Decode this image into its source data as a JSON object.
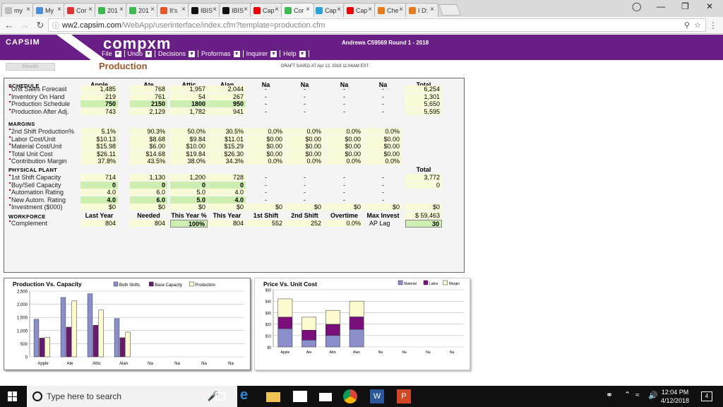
{
  "browser": {
    "tabs": [
      {
        "label": "my",
        "color": "#bdbdbd"
      },
      {
        "label": "My",
        "color": "#4a90d9"
      },
      {
        "label": "Cor",
        "color": "#d33"
      },
      {
        "label": "201",
        "color": "#3cba54"
      },
      {
        "label": "201",
        "color": "#3cba54"
      },
      {
        "label": "It's",
        "color": "#e8572a"
      },
      {
        "label": "IBIS",
        "color": "#111"
      },
      {
        "label": "IBIS",
        "color": "#111"
      },
      {
        "label": "Cap",
        "color": "#e00"
      },
      {
        "label": "Cor",
        "color": "#3cba54"
      },
      {
        "label": "Cap",
        "color": "#27a3d8"
      },
      {
        "label": "Cap",
        "color": "#e00"
      },
      {
        "label": "Che",
        "color": "#e87a1e"
      },
      {
        "label": "I D:",
        "color": "#e87a1e"
      }
    ],
    "active_tab_index": 9,
    "url_host": "ww2.capsim.com",
    "url_path": "/WebApp/userinterface/index.cfm?template=production.cfm"
  },
  "app": {
    "logo": "CAPSIM",
    "brand": "compxm",
    "round_info": "Andrews C59569 Round 1 - 2018",
    "menu": [
      "File",
      "Undo",
      "Decisions",
      "Proformas",
      "Inquirer",
      "Help"
    ],
    "results_button": "Results",
    "page_title": "Production",
    "draft_saved": "DRAFT SAVED AT Apr 12, 2018 11:04AM EST"
  },
  "products": [
    "Apple",
    "Ate",
    "Attic",
    "Alan",
    "Na",
    "Na",
    "Na",
    "Na"
  ],
  "total_label": "Total",
  "schedule": {
    "title": "SCHEDULE",
    "rows": [
      {
        "label": "Unit Sales Forecast",
        "values": [
          "1,485",
          "768",
          "1,957",
          "2,044",
          "-",
          "-",
          "-",
          "-"
        ],
        "total": "6,254"
      },
      {
        "label": "Inventory On Hand",
        "values": [
          "219",
          "761",
          "54",
          "267",
          "-",
          "-",
          "-",
          "-"
        ],
        "total": "1,301"
      },
      {
        "label": "Production Schedule",
        "values": [
          "750",
          "2150",
          "1800",
          "950",
          "-",
          "-",
          "-",
          "-"
        ],
        "total": "5,650"
      },
      {
        "label": "Production After Adj.",
        "values": [
          "743",
          "2,129",
          "1,782",
          "941",
          "-",
          "-",
          "-",
          "-"
        ],
        "total": "5,595"
      }
    ]
  },
  "margins": {
    "title": "MARGINS",
    "rows": [
      {
        "label": "2nd Shift Production%",
        "values": [
          "5.1%",
          "90.3%",
          "50.0%",
          "30.5%",
          "0.0%",
          "0.0%",
          "0.0%",
          "0.0%"
        ]
      },
      {
        "label": "Labor Cost/Unit",
        "values": [
          "$10.13",
          "$8.68",
          "$9.84",
          "$11.01",
          "$0.00",
          "$0.00",
          "$0.00",
          "$0.00"
        ]
      },
      {
        "label": "Material Cost/Unit",
        "values": [
          "$15.98",
          "$6.00",
          "$10.00",
          "$15.29",
          "$0.00",
          "$0.00",
          "$0.00",
          "$0.00"
        ]
      },
      {
        "label": "Total Unit Cost",
        "values": [
          "$26.11",
          "$14.68",
          "$19.84",
          "$26.30",
          "$0.00",
          "$0.00",
          "$0.00",
          "$0.00"
        ]
      },
      {
        "label": "Contribution Margin",
        "values": [
          "37.8%",
          "43.5%",
          "38.0%",
          "34.3%",
          "0.0%",
          "0.0%",
          "0.0%",
          "0.0%"
        ]
      }
    ]
  },
  "plant": {
    "title": "PHYSICAL PLANT",
    "total_label": "Total",
    "rows": [
      {
        "label": "1st Shift Capacity",
        "values": [
          "714",
          "1,130",
          "1,200",
          "728",
          "-",
          "-",
          "-",
          "-"
        ],
        "total": "3,772"
      },
      {
        "label": "Buy/Sell Capacity",
        "values": [
          "0",
          "0",
          "0",
          "0",
          "-",
          "-",
          "-",
          "-"
        ],
        "total": "0"
      },
      {
        "label": "Automation Rating",
        "values": [
          "4.0",
          "6.0",
          "5.0",
          "4.0",
          "-",
          "-",
          "-",
          "-"
        ],
        "total": ""
      },
      {
        "label": "New Autom. Rating",
        "values": [
          "4.0",
          "6.0",
          "5.0",
          "4.0",
          "-",
          "-",
          "-",
          "-"
        ],
        "total": ""
      },
      {
        "label": "Investment ($000)",
        "values": [
          "$0",
          "$0",
          "$0",
          "$0",
          "$0",
          "$0",
          "$0",
          "$0"
        ],
        "total": "$0"
      }
    ]
  },
  "workforce": {
    "title": "WORKFORCE",
    "headers": [
      "Last Year",
      "Needed",
      "This Year %",
      "This Year",
      "1st Shift",
      "2nd Shift",
      "Overtime",
      "Max Invest"
    ],
    "row_label": "Complement",
    "values": [
      "804",
      "804",
      "100",
      "804",
      "552",
      "252",
      "0.0%"
    ],
    "percent_sign": "%",
    "max_invest": "$ 59,463",
    "ap_lag_label": "AP Lag",
    "ap_lag": "30"
  },
  "chart_data": [
    {
      "type": "bar",
      "title": "Production Vs. Capacity",
      "categories": [
        "Apple",
        "Ate",
        "Attic",
        "Alan",
        "Na",
        "Na",
        "Na",
        "Na"
      ],
      "series": [
        {
          "name": "Both Shifts",
          "values": [
            1428,
            2260,
            2400,
            1456,
            0,
            0,
            0,
            0
          ],
          "color": "#8a8fcc"
        },
        {
          "name": "Base Capacity",
          "values": [
            714,
            1130,
            1200,
            728,
            0,
            0,
            0,
            0
          ],
          "color": "#6a1a6e"
        },
        {
          "name": "Production",
          "values": [
            743,
            2129,
            1782,
            941,
            0,
            0,
            0,
            0
          ],
          "color": "#fdfbcf"
        }
      ],
      "ylim": [
        0,
        2500
      ],
      "yticks": [
        "0",
        "500",
        "1,000",
        "1,500",
        "2,000",
        "2,500"
      ],
      "grid": true,
      "legend": "top"
    },
    {
      "type": "bar",
      "stacked": true,
      "title": "Price Vs. Unit Cost",
      "categories": [
        "Apple",
        "Ate",
        "Attic",
        "Alan",
        "Na",
        "Na",
        "Na",
        "Na"
      ],
      "series": [
        {
          "name": "Material",
          "values": [
            15.98,
            6.0,
            10.0,
            15.29,
            0,
            0,
            0,
            0
          ],
          "color": "#8a8fcc"
        },
        {
          "name": "Labor",
          "values": [
            10.13,
            8.68,
            9.84,
            11.01,
            0,
            0,
            0,
            0
          ],
          "color": "#7a0e7a"
        },
        {
          "name": "Margin",
          "values": [
            15.89,
            11.32,
            12.16,
            13.7,
            0,
            0,
            0,
            0
          ],
          "color": "#fdfbcf"
        }
      ],
      "ylim": [
        0,
        50
      ],
      "yticks": [
        "$0",
        "$10",
        "$20",
        "$30",
        "$40",
        "$50"
      ],
      "grid": true,
      "legend": "top-right"
    }
  ],
  "taskbar": {
    "search_placeholder": "Type here to search",
    "time": "12:04 PM",
    "date": "4/12/2018",
    "notifications": "4"
  }
}
